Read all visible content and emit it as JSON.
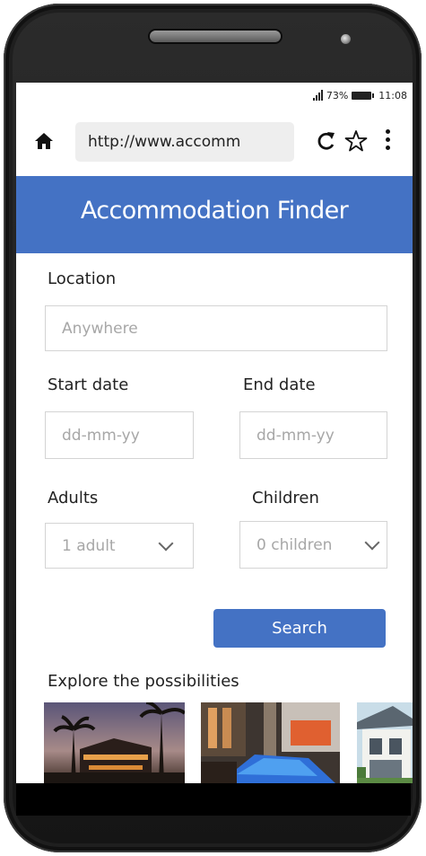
{
  "status": {
    "battery": "73%",
    "time": "11:08"
  },
  "browser": {
    "url": "http://www.accomm"
  },
  "header": {
    "title": "Accommodation Finder"
  },
  "form": {
    "location_label": "Location",
    "location_placeholder": "Anywhere",
    "start_label": "Start date",
    "start_placeholder": "dd-mm-yy",
    "end_label": "End date",
    "end_placeholder": "dd-mm-yy",
    "adults_label": "Adults",
    "adults_value": "1 adult",
    "children_label": "Children",
    "children_value": "0 children",
    "search_label": "Search"
  },
  "explore": {
    "title": "Explore the possibilities",
    "images": [
      "resort-palms-dusk",
      "hotel-pool-night",
      "modern-villa"
    ]
  },
  "colors": {
    "accent": "#4472c4",
    "frame": "#1f1f1f"
  }
}
